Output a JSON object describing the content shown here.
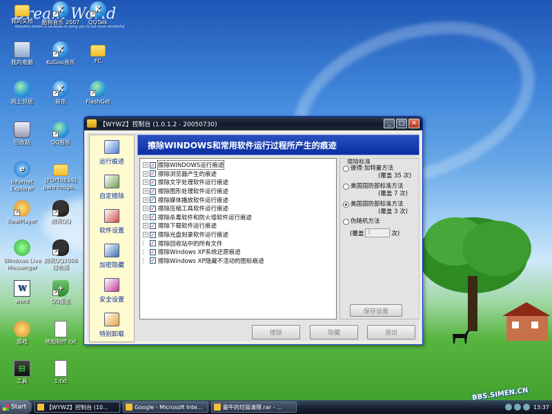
{
  "desktop": {
    "brand": "Dream World",
    "brand_sub": "Beautiful dream in windows to bring you to the most wonderful",
    "watermark": "BBS.SIMEN.CN",
    "icons": [
      {
        "label": "我的文档",
        "glyph": "",
        "icon": "folder-icon",
        "shortcut": false
      },
      {
        "label": "酷狗音乐 2007",
        "glyph": "K",
        "icon": "kugou-icon",
        "shortcut": true
      },
      {
        "label": "QQTalk",
        "glyph": "K",
        "icon": "qqtalk-icon",
        "shortcut": true
      },
      {
        "label": "我的电脑",
        "glyph": "",
        "icon": "computer-icon",
        "shortcut": false
      },
      {
        "label": "KuGoo音乐",
        "glyph": "K",
        "icon": "kugoo-icon",
        "shortcut": true
      },
      {
        "label": "FC",
        "glyph": "",
        "icon": "folder-icon",
        "shortcut": false
      },
      {
        "label": "网上邻居",
        "glyph": "",
        "icon": "network-icon",
        "shortcut": false
      },
      {
        "label": "音乐",
        "glyph": "K",
        "icon": "music-icon",
        "shortcut": true
      },
      {
        "label": "FlashGet",
        "glyph": "",
        "icon": "flashget-icon",
        "shortcut": true
      },
      {
        "label": "回收站",
        "glyph": "",
        "icon": "recycle-bin-icon",
        "shortcut": false
      },
      {
        "label": "QQ音乐",
        "glyph": "",
        "icon": "qq-music-icon",
        "shortcut": true
      },
      {
        "label": "Internet Explorer",
        "glyph": "e",
        "icon": "ie-icon",
        "shortcut": false
      },
      {
        "label": "[FOrTRESS] pare rouge...",
        "glyph": "",
        "icon": "folder-icon",
        "shortcut": false
      },
      {
        "label": "RealPlayer",
        "glyph": "",
        "icon": "realplayer-icon",
        "shortcut": true
      },
      {
        "label": "腾讯QQ",
        "glyph": "",
        "icon": "qq-icon",
        "shortcut": true
      },
      {
        "label": "Windows Live Messenger",
        "glyph": "",
        "icon": "messenger-icon",
        "shortcut": false
      },
      {
        "label": "腾讯QQ2006 绿色版",
        "glyph": "",
        "icon": "qq-icon",
        "shortcut": true
      },
      {
        "label": "word",
        "glyph": "W",
        "icon": "word-icon",
        "shortcut": false
      },
      {
        "label": "QQ医生",
        "glyph": "+",
        "icon": "qq-doctor-icon",
        "shortcut": true
      },
      {
        "label": "游戏",
        "glyph": "",
        "icon": "games-icon",
        "shortcut": false
      },
      {
        "label": "地图制作.txt",
        "glyph": "",
        "icon": "text-file-icon",
        "shortcut": false
      },
      {
        "label": "工具",
        "glyph": "▤",
        "icon": "tools-icon",
        "shortcut": false
      },
      {
        "label": "1.txt",
        "glyph": "",
        "icon": "text-file-icon",
        "shortcut": false
      }
    ]
  },
  "window": {
    "title": "【WYWZ】控制台 (1.0.1.2 - 20050730)",
    "controls": {
      "minimize": "_",
      "maximize": "□",
      "close": "✕"
    },
    "header": "擦除WINDOWS和常用软件运行过程所产生的痕迹",
    "sidebar": [
      {
        "label": "运行痕迹",
        "icon": "trace-icon",
        "color": "#4a7fd6"
      },
      {
        "label": "自定擦除",
        "icon": "custom-erase-icon",
        "color": "#6fa14a"
      },
      {
        "label": "软件设置",
        "icon": "software-settings-icon",
        "color": "#d04f3c"
      },
      {
        "label": "加密隐藏",
        "icon": "encrypt-hide-icon",
        "color": "#3a6fb0"
      },
      {
        "label": "安全设置",
        "icon": "security-settings-icon",
        "color": "#c23a9a"
      },
      {
        "label": "特别卸载",
        "icon": "special-uninstall-icon",
        "color": "#e2a43a"
      }
    ],
    "items": [
      {
        "label": "擦除WINDOWS运行痕迹",
        "expandable": true,
        "selected": true
      },
      {
        "label": "擦除浏览器产生的痕迹",
        "expandable": true,
        "selected": false
      },
      {
        "label": "擦除文字处理软件运行痕迹",
        "expandable": true,
        "selected": false
      },
      {
        "label": "擦除图形处理软件运行痕迹",
        "expandable": true,
        "selected": false
      },
      {
        "label": "擦除媒体播放软件运行痕迹",
        "expandable": true,
        "selected": false
      },
      {
        "label": "擦除压缩工具软件运行痕迹",
        "expandable": true,
        "selected": false
      },
      {
        "label": "擦除杀毒软件和防火墙软件运行痕迹",
        "expandable": true,
        "selected": false
      },
      {
        "label": "擦除下载软件运行痕迹",
        "expandable": true,
        "selected": false
      },
      {
        "label": "擦除光盘刻录软件运行痕迹",
        "expandable": true,
        "selected": false
      },
      {
        "label": "擦除回收站中的所有文件",
        "expandable": false,
        "selected": false
      },
      {
        "label": "擦除Windows XP系统还原痕迹",
        "expandable": false,
        "selected": false
      },
      {
        "label": "擦除Windows XP隐藏不活动的图标痕迹",
        "expandable": false,
        "selected": false
      }
    ],
    "standard": {
      "legend": "擦除标准",
      "options": [
        {
          "line1": "彼得·加特曼方法",
          "line2": "(覆盖 35 次)",
          "checked": false
        },
        {
          "line1": "美国国防部标准方法",
          "line2": "(覆盖 7 次)",
          "checked": false
        },
        {
          "line1": "美国国防部标准方法",
          "line2": "(覆盖 3 次)",
          "checked": true
        },
        {
          "line1": "伪随机方法",
          "line2": "",
          "checked": false
        }
      ],
      "pass_prefix": "(覆盖",
      "pass_value": "1",
      "pass_suffix": "次)",
      "save_label": "保存设置"
    },
    "buttons": {
      "erase": "擦除",
      "hide": "隐藏",
      "exit": "退出"
    }
  },
  "taskbar": {
    "start": "Start",
    "tasks": [
      {
        "label": "【WYWZ】控制台 (10...",
        "active": true
      },
      {
        "label": "Google - Microsoft Inte...",
        "active": false
      },
      {
        "label": "最牛的垃圾清理.rar - ...",
        "active": false
      }
    ],
    "clock": "13:37"
  }
}
